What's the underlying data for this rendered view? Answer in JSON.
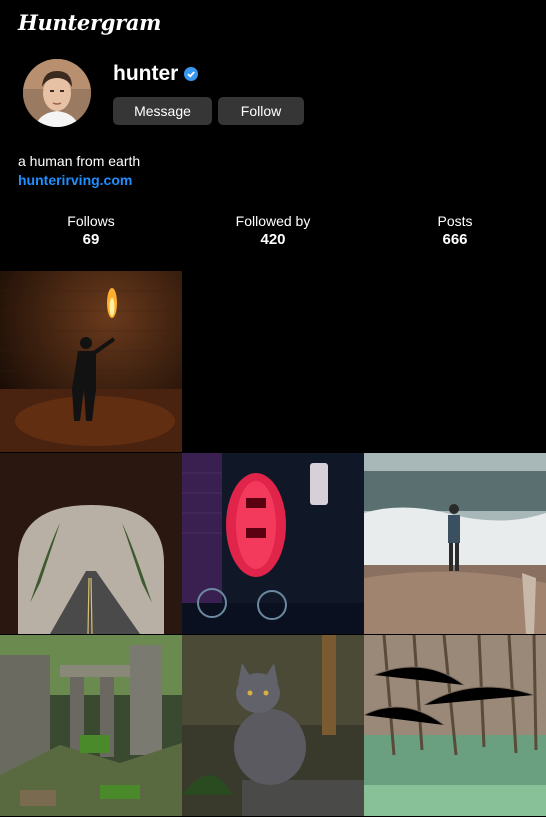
{
  "app": {
    "logo": "Huntergram"
  },
  "profile": {
    "username": "hunter",
    "verified": true,
    "bio": "a human from earth",
    "website": "hunterirving.com"
  },
  "actions": {
    "message_label": "Message",
    "follow_label": "Follow"
  },
  "stats": {
    "follows_label": "Follows",
    "follows_value": "69",
    "followed_label": "Followed by",
    "followed_value": "420",
    "posts_label": "Posts",
    "posts_value": "666"
  },
  "colors": {
    "background": "#000000",
    "button": "#363636",
    "link": "#1e90ff",
    "verified": "#3897f0"
  },
  "posts": [
    {
      "subject": "person-holding-flare-in-dark"
    },
    {
      "subject": "foggy-road-through-tunnel"
    },
    {
      "subject": "red-paper-lantern-at-night"
    },
    {
      "subject": "fisherman-on-beach"
    },
    {
      "subject": "jungle-temple-ruins"
    },
    {
      "subject": "grey-cat-on-wall"
    },
    {
      "subject": "flooded-forest-swamp"
    }
  ]
}
